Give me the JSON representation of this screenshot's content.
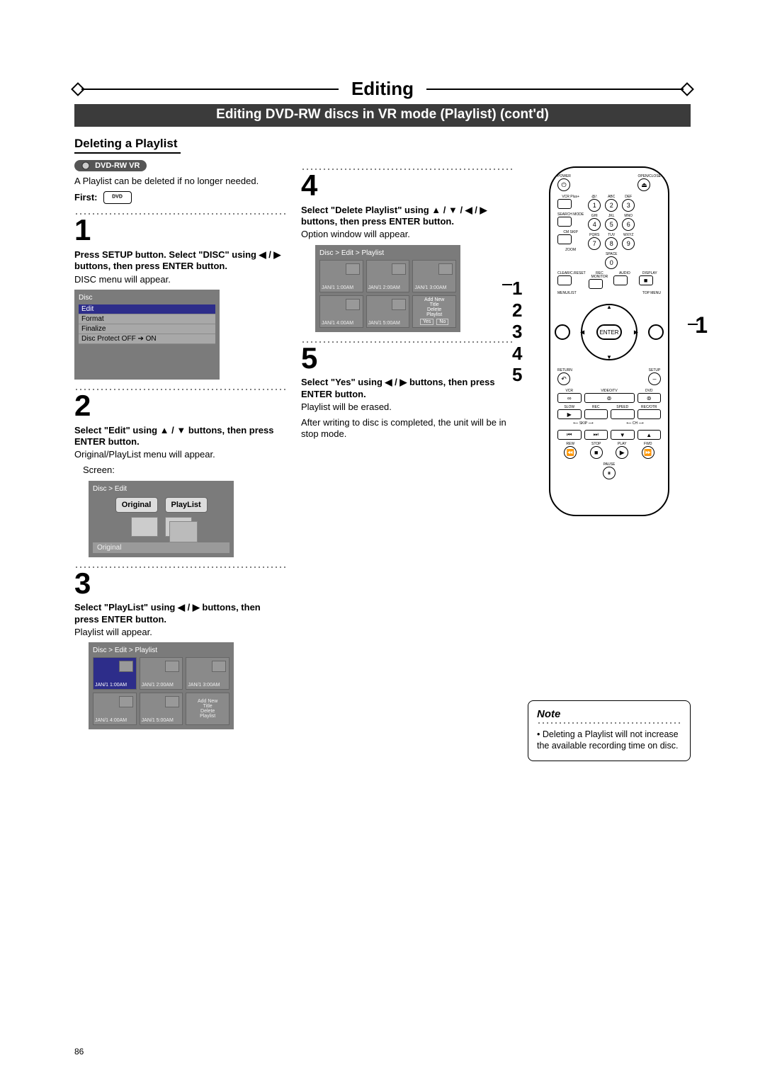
{
  "header": {
    "title": "Editing",
    "subtitle": "Editing DVD-RW discs in VR mode (Playlist) (cont'd)"
  },
  "section_heading": "Deleting a Playlist",
  "badge": "DVD-RW VR",
  "intro": "A Playlist can be deleted if no longer needed.",
  "first_label": "First:",
  "steps": {
    "s1": {
      "num": "1",
      "head": "Press SETUP button. Select \"DISC\" using ◀ / ▶ buttons, then press ENTER button.",
      "body": "DISC menu will appear."
    },
    "s2": {
      "num": "2",
      "head": "Select \"Edit\" using ▲ / ▼ buttons, then press ENTER button.",
      "body": "Original/PlayList menu will appear.",
      "screen_label": "Screen:"
    },
    "s3": {
      "num": "3",
      "head": "Select \"PlayList\" using ◀ / ▶ buttons, then press ENTER button.",
      "body": "Playlist will appear."
    },
    "s4": {
      "num": "4",
      "head": "Select \"Delete Playlist\" using ▲ / ▼ / ◀ / ▶ buttons, then press ENTER button.",
      "body": "Option window will appear."
    },
    "s5": {
      "num": "5",
      "head": "Select \"Yes\" using ◀ / ▶ buttons, then press ENTER button.",
      "body1": "Playlist will be erased.",
      "body2": "After writing to disc is completed, the unit will be in stop mode."
    }
  },
  "disc_menu": {
    "bc": "Disc",
    "items": [
      "Edit",
      "Format",
      "Finalize",
      "Disc Protect OFF ➔ ON"
    ]
  },
  "edit_menu": {
    "bc": "Disc > Edit",
    "tabs": [
      "Original",
      "PlayList"
    ],
    "status": "Original"
  },
  "playlist_menu": {
    "bc": "Disc > Edit > Playlist",
    "cells": [
      "JAN/1  1:00AM",
      "JAN/1  2:00AM",
      "JAN/1  3:00AM",
      "JAN/1  4:00AM",
      "JAN/1  5:00AM"
    ],
    "add_lines": [
      "Add New",
      "Title",
      "Delete",
      "Playlist"
    ]
  },
  "playlist_menu2": {
    "bc": "Disc > Edit > Playlist",
    "cells": [
      "JAN/1  1:00AM",
      "JAN/1  2:00AM",
      "JAN/1  3:00AM",
      "JAN/1  4:00AM",
      "JAN/1  5:00AM"
    ],
    "opt_lines": [
      "Add New",
      "Title",
      "Delete",
      "Playlist"
    ],
    "yes": "Yes",
    "no": "No"
  },
  "remote": {
    "power": "POWER",
    "open": "OPEN/CLOSE",
    "vcrplus": "VCR Plus+",
    "num_labels": [
      "@/:",
      "ABC",
      "DEF",
      "GHI",
      "JKL",
      "MNO",
      "PQRS",
      "TUV",
      "WXYZ",
      "SPACE"
    ],
    "nums": [
      "1",
      "2",
      "3",
      "4",
      "5",
      "6",
      "7",
      "8",
      "9",
      "0"
    ],
    "search": "SEARCH MODE",
    "cmskip": "CM SKIP",
    "zoom": "ZOOM",
    "clear": "CLEAR/C.RESET",
    "recmon": "REC MONITOR",
    "audio": "AUDIO",
    "display": "DISPLAY",
    "menulist": "MENU/LIST",
    "topmenu": "TOP MENU",
    "enter": "ENTER",
    "return": "RETURN",
    "setup": "SETUP",
    "vcr": "VCR",
    "vtv": "VIDEO/TV",
    "dvd": "DVD",
    "slow": "SLOW",
    "rec": "REC",
    "speed": "SPEED",
    "recotr": "REC/OTR",
    "skip": "SKIP",
    "ch": "CH",
    "rew": "REW",
    "stop": "STOP",
    "play": "PLAY",
    "fwd": "FWD",
    "pause": "PAUSE"
  },
  "step_index": [
    "1",
    "2",
    "3",
    "4",
    "5"
  ],
  "callout_right": "1",
  "note": {
    "title": "Note",
    "body": "• Deleting a Playlist will not increase the available recording time on disc."
  },
  "page_number": "86"
}
